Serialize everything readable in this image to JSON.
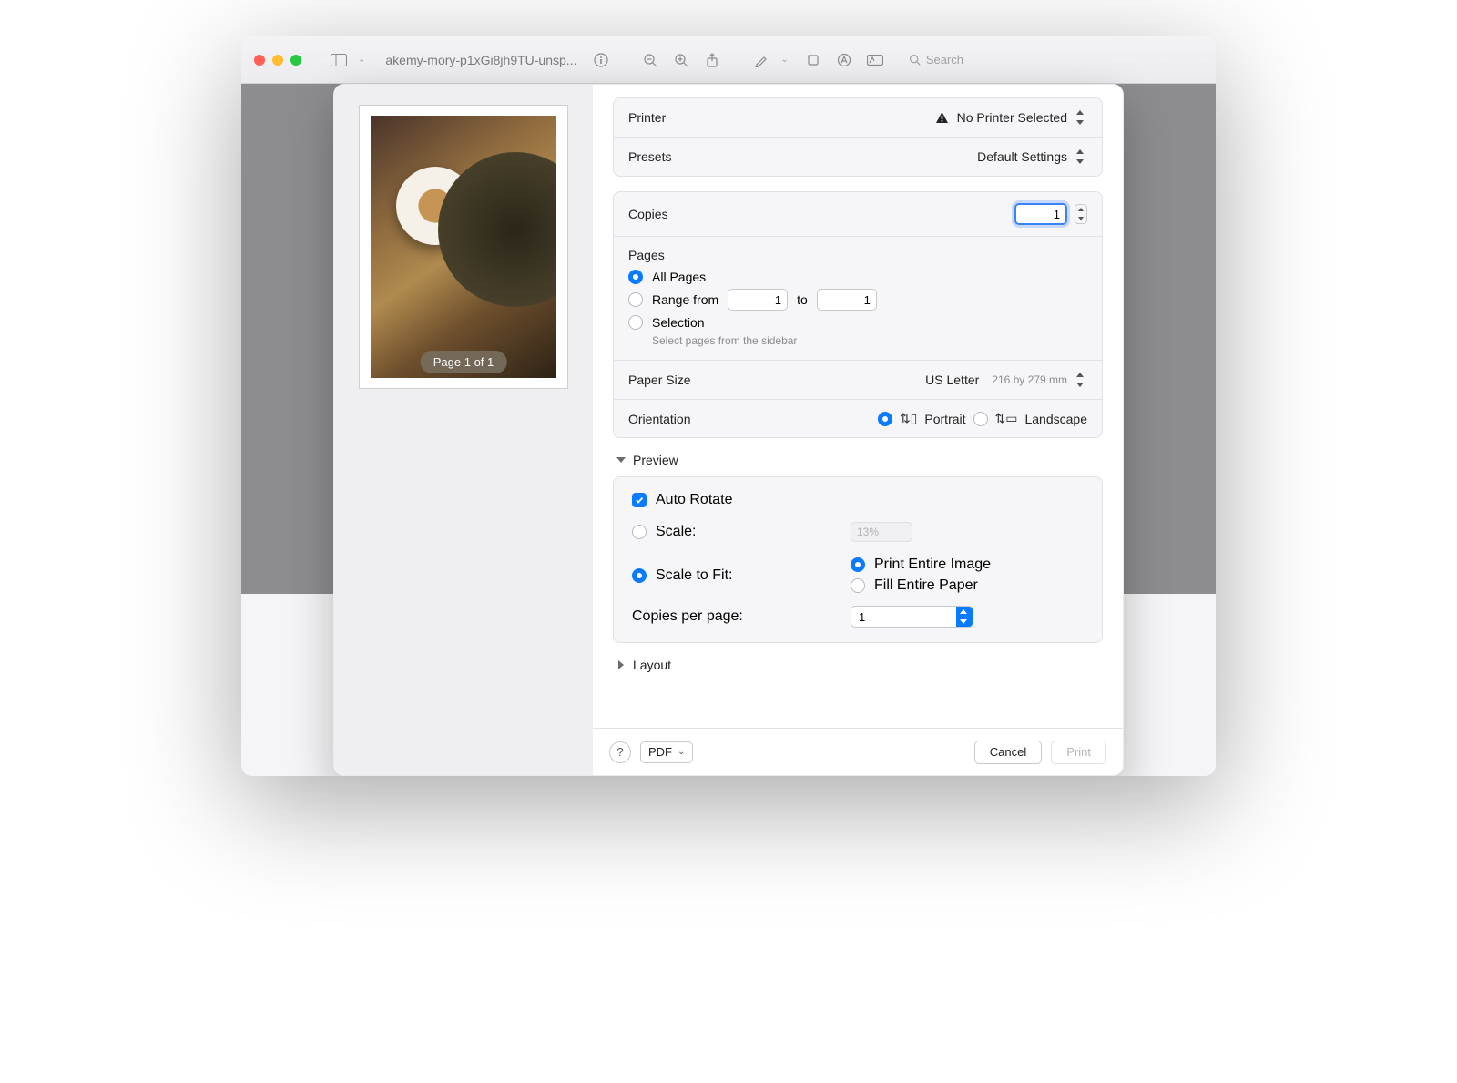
{
  "window": {
    "title": "akemy-mory-p1xGi8jh9TU-unsp...",
    "search_placeholder": "Search"
  },
  "preview_pane": {
    "page_badge": "Page 1 of 1"
  },
  "printer": {
    "label": "Printer",
    "value": "No Printer Selected"
  },
  "presets": {
    "label": "Presets",
    "value": "Default Settings"
  },
  "copies": {
    "label": "Copies",
    "value": "1"
  },
  "pages": {
    "label": "Pages",
    "all_label": "All Pages",
    "range_label": "Range from",
    "range_to_label": "to",
    "range_from": "1",
    "range_to": "1",
    "selection_label": "Selection",
    "selection_hint": "Select pages from the sidebar"
  },
  "paper_size": {
    "label": "Paper Size",
    "value": "US Letter",
    "dimensions": "216 by 279 mm"
  },
  "orientation": {
    "label": "Orientation",
    "portrait": "Portrait",
    "landscape": "Landscape"
  },
  "preview_section": {
    "title": "Preview",
    "auto_rotate": "Auto Rotate",
    "scale_label": "Scale:",
    "scale_value": "13%",
    "scale_fit_label": "Scale to Fit:",
    "print_entire": "Print Entire Image",
    "fill_paper": "Fill Entire Paper",
    "copies_per_page_label": "Copies per page:",
    "copies_per_page_value": "1"
  },
  "layout_section": {
    "title": "Layout"
  },
  "footer": {
    "pdf": "PDF",
    "cancel": "Cancel",
    "print": "Print"
  }
}
